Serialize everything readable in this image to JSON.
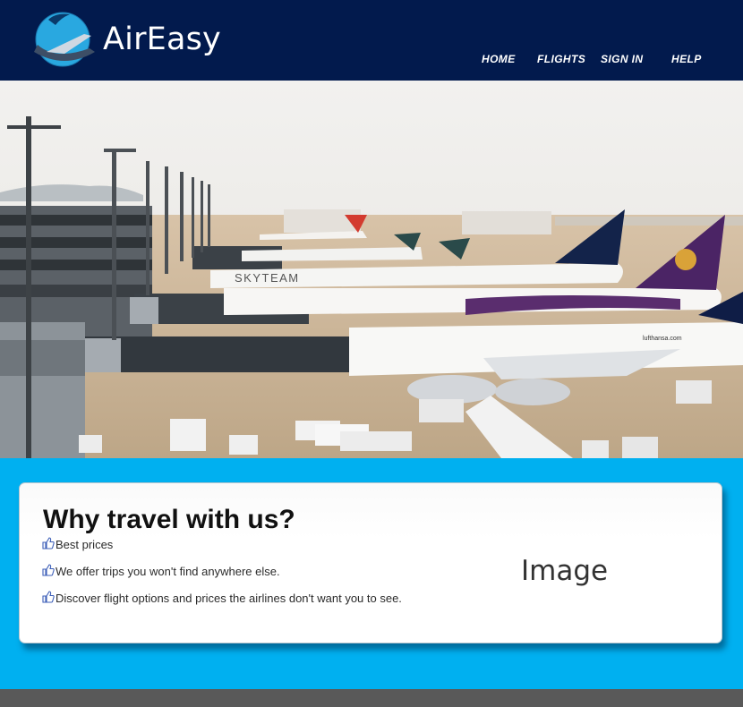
{
  "header": {
    "brand": "AirEasy",
    "logo_icon": "globe-plane-logo",
    "nav": [
      {
        "label": "HOME"
      },
      {
        "label": "FLIGHTS"
      },
      {
        "label": "SIGN IN"
      },
      {
        "label": "HELP"
      }
    ]
  },
  "hero": {
    "image": "airport-terminal-with-parked-airplanes-photo",
    "tail_text": "SKYTEAM",
    "fuselage_text": "lufthansa.com"
  },
  "why": {
    "title": "Why travel with us?",
    "bullet_icon": "thumbs-up-icon",
    "items": [
      "Best prices",
      "We offer trips you won't find anywhere else.",
      "Discover flight options and prices the airlines don't want you to see."
    ],
    "image_placeholder": "Image"
  },
  "colors": {
    "header_bg": "#021a4d",
    "section_bg": "#00b0f0",
    "card_bg": "#ffffff",
    "footer_bar": "#595959"
  }
}
